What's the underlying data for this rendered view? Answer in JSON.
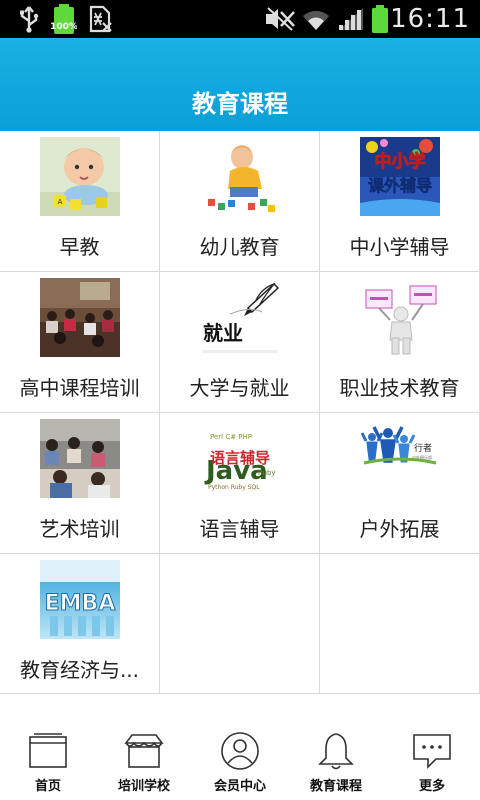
{
  "status_bar": {
    "time": "16:11",
    "battery_percent": "100%",
    "icons": [
      "usb-icon",
      "battery-icon",
      "notification-icon",
      "mute-icon",
      "wifi-icon",
      "signal-icon",
      "battery-icon"
    ]
  },
  "header": {
    "title": "教育课程"
  },
  "courses": [
    {
      "label": "早教",
      "icon": "baby-photo"
    },
    {
      "label": "幼儿教育",
      "icon": "toddler-photo"
    },
    {
      "label": "中小学辅导",
      "icon": "tutoring-logo"
    },
    {
      "label": "高中课程培训",
      "icon": "classroom-photo"
    },
    {
      "label": "大学与就业",
      "icon": "employment-graphic"
    },
    {
      "label": "职业技术教育",
      "icon": "figure-with-signs"
    },
    {
      "label": "艺术培训",
      "icon": "students-photo"
    },
    {
      "label": "语言辅导",
      "icon": "word-cloud"
    },
    {
      "label": "户外拓展",
      "icon": "outdoor-logo"
    },
    {
      "label": "教育经济与...",
      "icon": "emba-logo"
    }
  ],
  "tabs": [
    {
      "label": "首页",
      "icon": "home-icon"
    },
    {
      "label": "培训学校",
      "icon": "school-icon"
    },
    {
      "label": "会员中心",
      "icon": "user-icon"
    },
    {
      "label": "教育课程",
      "icon": "bell-icon"
    },
    {
      "label": "更多",
      "icon": "more-icon"
    }
  ],
  "colors": {
    "header": "#0ea6dc",
    "status_bar": "#000000",
    "battery": "#5ed93a"
  }
}
